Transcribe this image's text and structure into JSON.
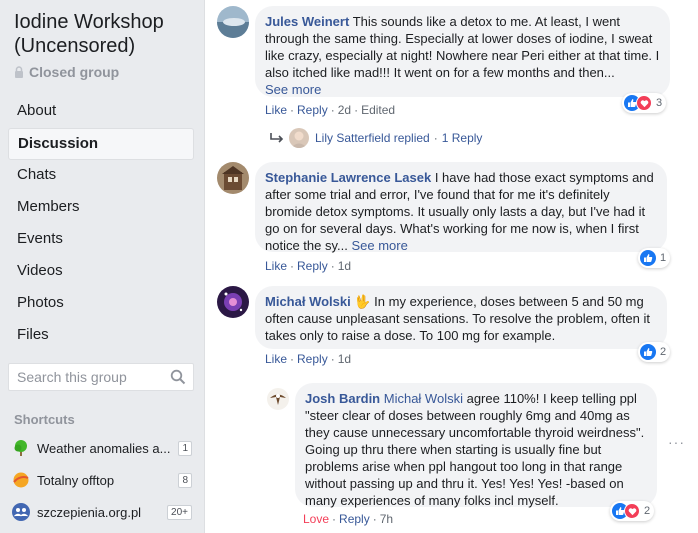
{
  "group": {
    "title": "Iodine Workshop (Uncensored)",
    "privacy": "Closed group"
  },
  "nav": [
    "About",
    "Discussion",
    "Chats",
    "Members",
    "Events",
    "Videos",
    "Photos",
    "Files"
  ],
  "search": {
    "placeholder": "Search this group"
  },
  "shortcuts": {
    "title": "Shortcuts",
    "items": [
      {
        "label": "Weather anomalies a...",
        "badge": "1"
      },
      {
        "label": "Totalny offtop",
        "badge": "8"
      },
      {
        "label": "szczepienia.org.pl",
        "badge": "20+"
      }
    ]
  },
  "comments": [
    {
      "author": "Jules Weinert",
      "text": "This sounds like a detox to me. At least, I went through the same thing. Especially at lower doses of iodine, I sweat like crazy, especially at night! Nowhere near Peri either at that time. I also itched like mad!!! It went on for a few months and then...",
      "see_more": "See more",
      "like": "Like",
      "reply": "Reply",
      "time": "2d",
      "edited": "Edited",
      "reaction_count": "3",
      "replied": {
        "name": "Lily Satterfield replied",
        "dot": "·",
        "count": "1 Reply"
      }
    },
    {
      "author": "Stephanie Lawrence Lasek",
      "text": "I have had those exact symptoms and after some trial and error, I've found that for me it's definitely bromide detox symptoms. It usually only lasts a day, but I've had it go on for several days. What's working for me now is, when I first notice the sy...",
      "see_more": "See more",
      "like": "Like",
      "reply": "Reply",
      "time": "1d",
      "reaction_count": "1"
    },
    {
      "author": "Michał Wolski",
      "emoji": "🖖",
      "text": "In my experience, doses between 5 and 50 mg often cause unpleasant sensations. To resolve the problem, often it takes only to raise a dose. To 100 mg for example.",
      "like": "Like",
      "reply": "Reply",
      "time": "1d",
      "reaction_count": "2"
    },
    {
      "author": "Josh Bardin",
      "mention": "Michał Wolski",
      "text": "agree 110%! I keep telling ppl \"steer clear of doses between roughly 6mg and 40mg as they cause unnecessary uncomfortable thyroid weirdness\". Going up thru there when starting is usually fine but problems arise when ppl hangout too long in that range without passing up and thru it. Yes! Yes! Yes! -based on many experiences of many folks incl myself.",
      "love": "Love",
      "reply": "Reply",
      "time": "7h",
      "reaction_count": "2"
    }
  ],
  "more_menu": "···",
  "colors": {
    "link": "#385898",
    "bubble": "#f2f3f5",
    "sidebar": "#e9ebee",
    "like": "#1877f2",
    "love": "#f33e58"
  }
}
